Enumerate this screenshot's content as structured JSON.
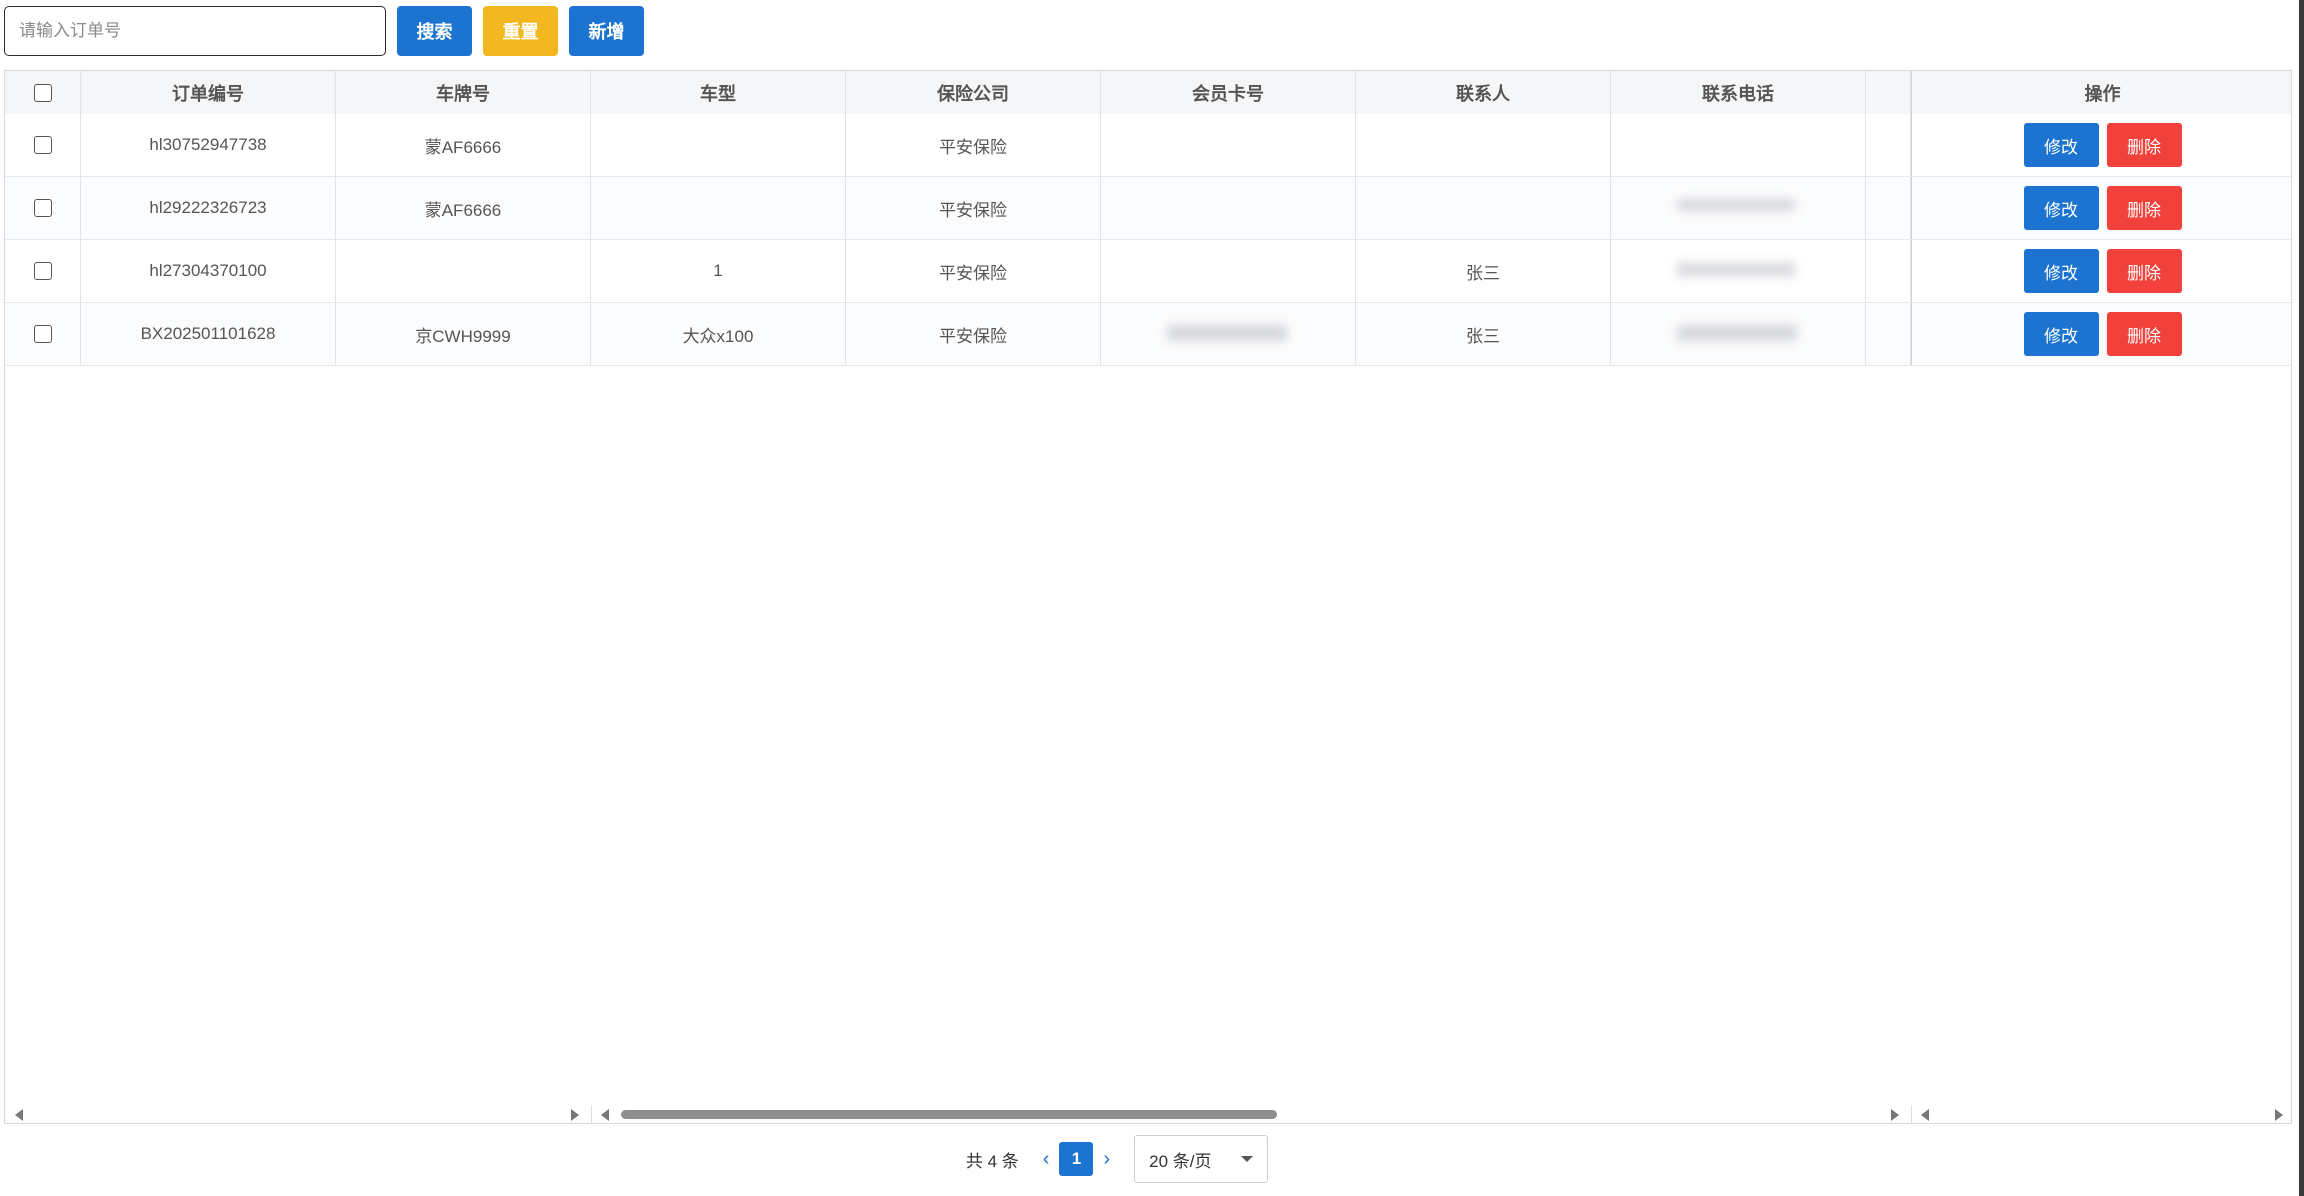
{
  "search": {
    "placeholder": "请输入订单号",
    "search_label": "搜索",
    "reset_label": "重置",
    "add_label": "新增"
  },
  "table": {
    "columns": [
      "订单编号",
      "车牌号",
      "车型",
      "保险公司",
      "会员卡号",
      "联系人",
      "联系电话",
      "",
      "操作"
    ],
    "rows": [
      {
        "order_no": "hl30752947738",
        "plate": "蒙AF6666",
        "model": "",
        "insurer": "平安保险",
        "member_card": "",
        "contact": "",
        "phone": ""
      },
      {
        "order_no": "hl29222326723",
        "plate": "蒙AF6666",
        "model": "",
        "insurer": "平安保险",
        "member_card": "",
        "contact": "",
        "phone": ""
      },
      {
        "order_no": "hl27304370100",
        "plate": "",
        "model": "1",
        "insurer": "平安保险",
        "member_card": "",
        "contact": "张三",
        "phone": ""
      },
      {
        "order_no": "BX202501101628",
        "plate": "京CWH9999",
        "model": "大众x100",
        "insurer": "平安保险",
        "member_card": "",
        "contact": "张三",
        "phone": ""
      }
    ],
    "edit_label": "修改",
    "delete_label": "删除"
  },
  "pagination": {
    "total_text": "共 4 条",
    "current_page": "1",
    "page_size": "20 条/页"
  },
  "colors": {
    "primary": "#1d74d0",
    "warning": "#f3b71f",
    "danger": "#f2413a"
  }
}
